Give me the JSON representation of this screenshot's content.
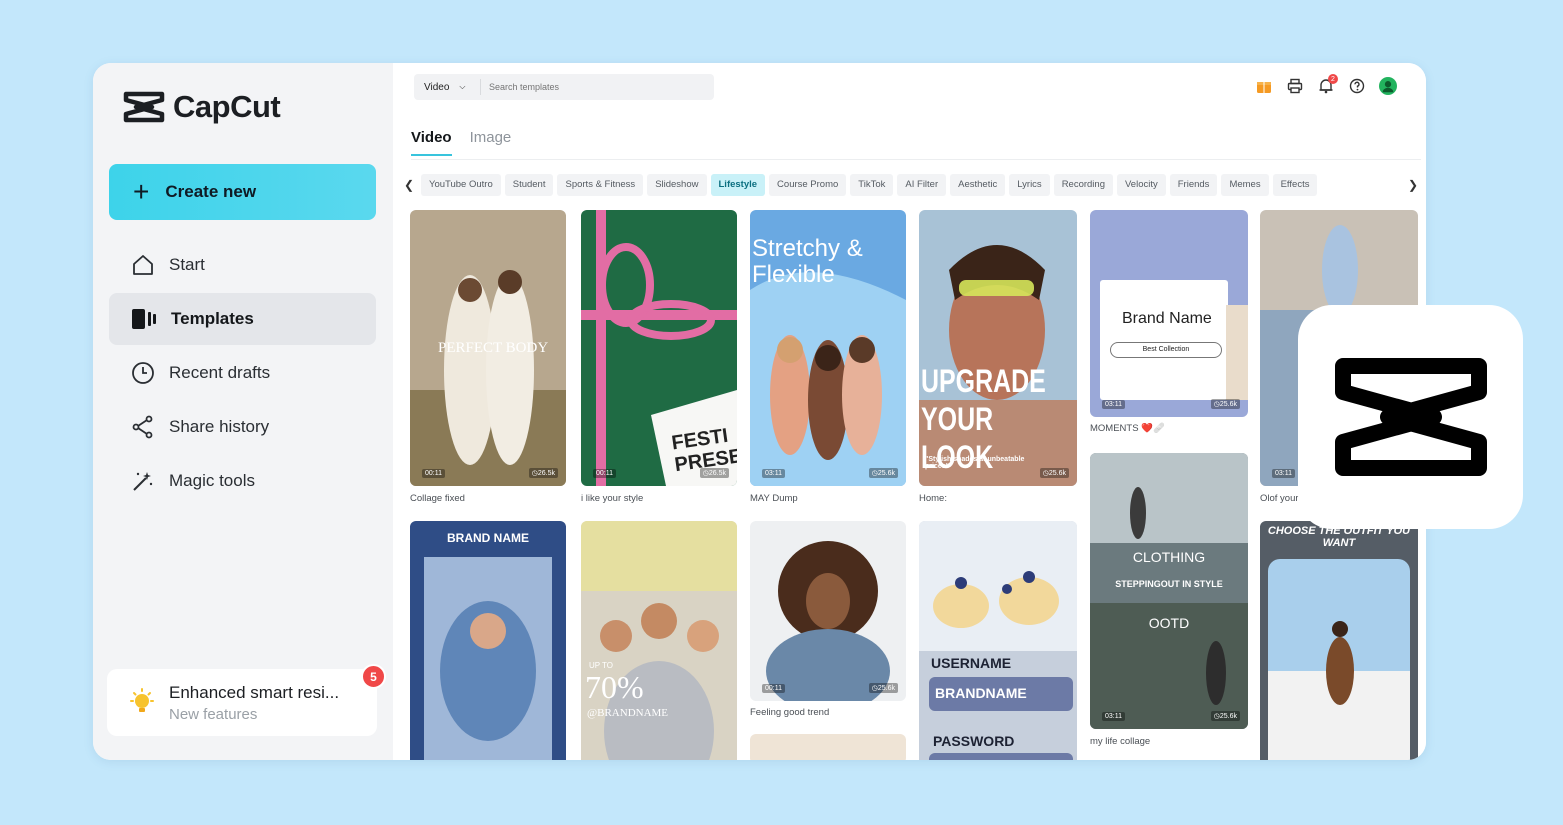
{
  "app": {
    "name": "CapCut"
  },
  "sidebar": {
    "create_label": "Create new",
    "items": [
      {
        "label": "Start",
        "icon": "home-icon"
      },
      {
        "label": "Templates",
        "icon": "templates-icon",
        "active": true
      },
      {
        "label": "Recent drafts",
        "icon": "clock-icon"
      },
      {
        "label": "Share history",
        "icon": "share-icon"
      },
      {
        "label": "Magic tools",
        "icon": "magic-wand-icon"
      }
    ],
    "feature": {
      "title": "Enhanced smart resi...",
      "subtitle": "New features",
      "badge": "5"
    }
  },
  "header": {
    "search_type": "Video",
    "search_placeholder": "Search templates",
    "notification_count": "2",
    "icons": [
      "gift-icon",
      "printer-icon",
      "bell-icon",
      "help-icon",
      "avatar-icon"
    ]
  },
  "tabs": [
    "Video",
    "Image"
  ],
  "categories": [
    "YouTube Outro",
    "Student",
    "Sports & Fitness",
    "Slideshow",
    "Lifestyle",
    "Course Promo",
    "TikTok",
    "AI Filter",
    "Aesthetic",
    "Lyrics",
    "Recording",
    "Velocity",
    "Friends",
    "Memes",
    "Effects"
  ],
  "active_category": "Lifestyle",
  "templates": [
    {
      "caption": "Collage fixed",
      "duration": "00:11",
      "uses": "26.5k",
      "overlay": "PERFECT BODY"
    },
    {
      "caption": "i like your style",
      "duration": "00:11",
      "uses": "26.5k",
      "overlay": "FESTI PRESEN"
    },
    {
      "caption": "MAY Dump",
      "duration": "03:11",
      "uses": "25.6k",
      "overlay": "Stretchy & Flexible"
    },
    {
      "caption": "Home:",
      "duration": "03:11",
      "uses": "25.6k",
      "overlay": "UPGRADE YOUR LOOK",
      "overlay2": "\"Stylish shades at unbeatable prices!\""
    },
    {
      "caption": "MOMENTS ❤️🩹",
      "duration": "03:11",
      "uses": "25.6k",
      "overlay": "Brand Name",
      "overlay2": "Best Collection"
    },
    {
      "caption": "Olof your",
      "duration": "03:11",
      "uses": ""
    },
    {
      "caption": "",
      "overlay": "BRAND NAME"
    },
    {
      "caption": "",
      "overlay": "70%",
      "overlay2": "UP TO",
      "overlay3": "@BRANDNAME"
    },
    {
      "caption": "Feeling good trend",
      "duration": "00:11",
      "uses": "25.6k"
    },
    {
      "caption": "",
      "overlay": "USERNAME",
      "overlay2": "BRANDNAME",
      "overlay3": "PASSWORD"
    },
    {
      "caption": "my life collage",
      "duration": "03:11",
      "uses": "25.6k",
      "overlay": "CLOTHING",
      "overlay2": "STEPPINGOUT IN STYLE",
      "overlay3": "OOTD"
    },
    {
      "caption": "",
      "overlay": "CHOOSE THE OUTFIT YOU WANT"
    }
  ]
}
